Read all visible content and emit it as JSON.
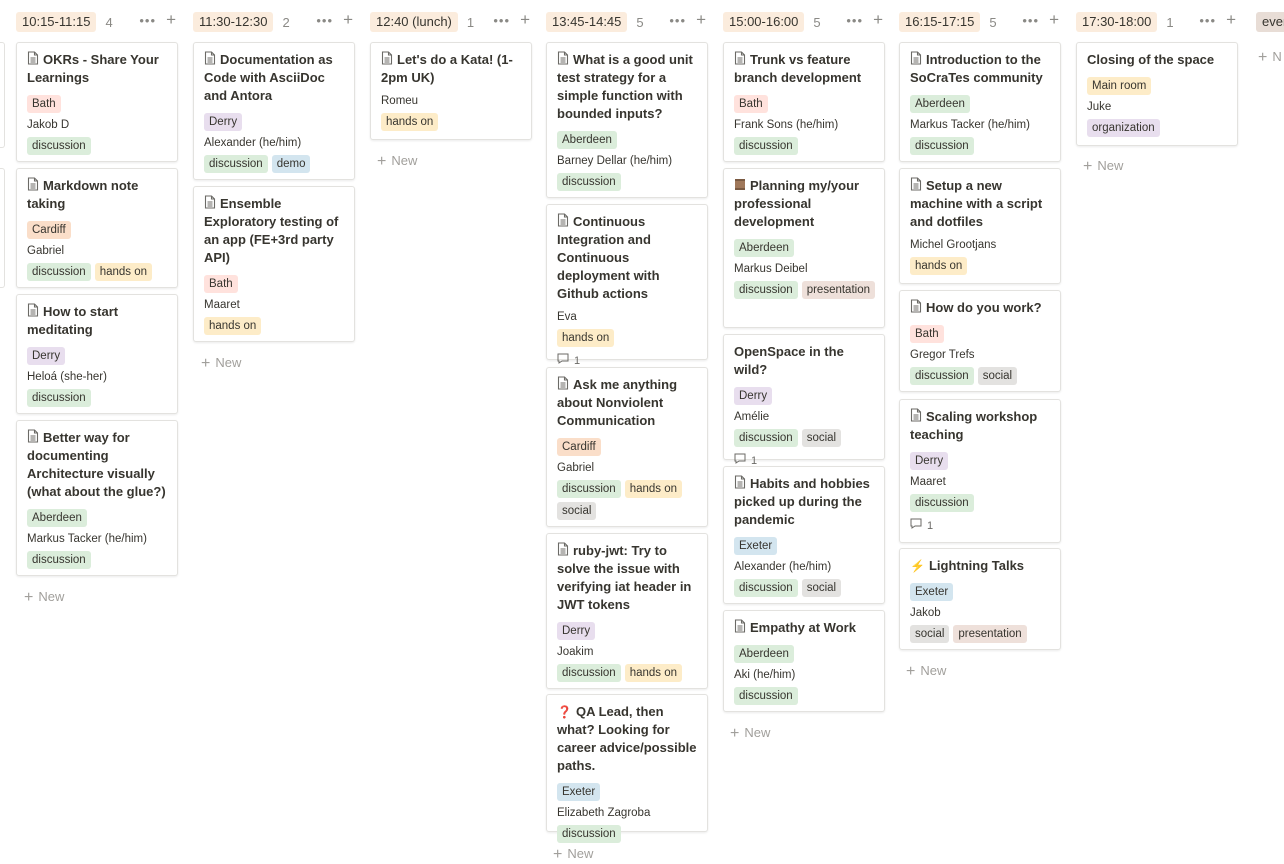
{
  "columns": [
    {
      "title": "10:15-11:15",
      "count": "4",
      "new_label": "New",
      "cards": [
        {
          "title": "OKRs - Share Your Learnings",
          "icon": "page-icon",
          "location": "Bath",
          "person": "Jakob D",
          "tags": [
            "discussion"
          ]
        },
        {
          "title": "Markdown note taking",
          "icon": "page-icon",
          "location": "Cardiff",
          "person": "Gabriel",
          "tags": [
            "discussion",
            "hands on"
          ]
        },
        {
          "title": "How to start meditating",
          "icon": "page-icon",
          "location": "Derry",
          "person": "Heloá (she-her)",
          "tags": [
            "discussion"
          ]
        },
        {
          "title": "Better way for documenting Architecture visually (what about the glue?)",
          "icon": "page-icon",
          "location": "Aberdeen",
          "person": "Markus Tacker (he/him)",
          "tags": [
            "discussion"
          ]
        }
      ]
    },
    {
      "title": "11:30-12:30",
      "count": "2",
      "new_label": "New",
      "cards": [
        {
          "title": "Documentation as Code with AsciiDoc and Antora",
          "icon": "page-icon",
          "location": "Derry",
          "person": "Alexander (he/him)",
          "tags": [
            "discussion",
            "demo"
          ]
        },
        {
          "title": "Ensemble Exploratory testing of an app (FE+3rd party API)",
          "icon": "page-icon",
          "location": "Bath",
          "person": "Maaret",
          "tags": [
            "hands on"
          ]
        }
      ]
    },
    {
      "title": "12:40 (lunch)",
      "count": "1",
      "new_label": "New",
      "cards": [
        {
          "title": "Let's do a Kata! (1-2pm UK)",
          "icon": "page-icon",
          "location": "",
          "person": "Romeu",
          "tags": [
            "hands on"
          ]
        }
      ]
    },
    {
      "title": "13:45-14:45",
      "count": "5",
      "new_label": "New",
      "cards": [
        {
          "title": "What is a good unit test strategy for a simple function with bounded inputs?",
          "icon": "page-icon",
          "location": "Aberdeen",
          "person": "Barney Dellar (he/him)",
          "tags": [
            "discussion"
          ]
        },
        {
          "title": "Continuous Integration and Continuous deployment with Github actions",
          "icon": "page-icon",
          "location": "",
          "person": "Eva",
          "tags": [
            "hands on"
          ],
          "comments": "1"
        },
        {
          "title": "Ask me anything about Nonviolent Communication",
          "icon": "page-icon",
          "location": "Cardiff",
          "person": "Gabriel",
          "tags": [
            "discussion",
            "hands on",
            "social"
          ]
        },
        {
          "title": "ruby-jwt: Try to solve the issue with verifying iat header in JWT tokens",
          "icon": "page-icon",
          "location": "Derry",
          "person": "Joakim",
          "tags": [
            "discussion",
            "hands on"
          ]
        },
        {
          "title": "QA Lead, then what? Looking for career advice/possible paths.",
          "icon": "question-icon",
          "location": "Exeter",
          "person": "Elizabeth Zagroba",
          "tags": [
            "discussion"
          ]
        }
      ]
    },
    {
      "title": "15:00-16:00",
      "count": "5",
      "new_label": "New",
      "cards": [
        {
          "title": "Trunk vs feature branch development",
          "icon": "page-icon",
          "location": "Bath",
          "person": "Frank Sons (he/him)",
          "tags": [
            "discussion"
          ]
        },
        {
          "title": "Planning my/your professional development",
          "icon": "scroll-icon",
          "location": "Aberdeen",
          "person": "Markus Deibel",
          "tags": [
            "discussion",
            "presentation"
          ]
        },
        {
          "title": "OpenSpace in the wild?",
          "icon": "",
          "location": "Derry",
          "person": "Amélie",
          "tags": [
            "discussion",
            "social"
          ],
          "comments": "1"
        },
        {
          "title": "Habits and hobbies picked up during the pandemic",
          "icon": "page-icon",
          "location": "Exeter",
          "person": "Alexander (he/him)",
          "tags": [
            "discussion",
            "social"
          ]
        },
        {
          "title": "Empathy at Work",
          "icon": "page-icon",
          "location": "Aberdeen",
          "person": "Aki (he/him)",
          "tags": [
            "discussion"
          ]
        }
      ]
    },
    {
      "title": "16:15-17:15",
      "count": "5",
      "new_label": "New",
      "cards": [
        {
          "title": "Introduction to the SoCraTes community",
          "icon": "page-icon",
          "location": "Aberdeen",
          "person": "Markus Tacker (he/him)",
          "tags": [
            "discussion"
          ]
        },
        {
          "title": "Setup a new machine  with a script and dotfiles",
          "icon": "page-icon",
          "location": "",
          "person": "Michel Grootjans",
          "tags": [
            "hands on"
          ]
        },
        {
          "title": "How do you work?",
          "icon": "page-icon",
          "location": "Bath",
          "person": "Gregor Trefs",
          "tags": [
            "discussion",
            "social"
          ]
        },
        {
          "title": "Scaling workshop teaching",
          "icon": "page-icon",
          "location": "Derry",
          "person": "Maaret",
          "tags": [
            "discussion"
          ],
          "comments": "1"
        },
        {
          "title": "Lightning Talks",
          "icon": "lightning-icon",
          "location": "Exeter",
          "person": "Jakob",
          "tags": [
            "social",
            "presentation"
          ]
        }
      ]
    },
    {
      "title": "17:30-18:00",
      "count": "1",
      "new_label": "New",
      "cards": [
        {
          "title": "Closing of the space",
          "icon": "",
          "location": "Main room",
          "person": "Juke",
          "tags": [
            "organization"
          ]
        }
      ]
    },
    {
      "title": "even",
      "count": "",
      "new_label": "N",
      "cards": []
    }
  ],
  "colors": {
    "header_tag": "#fbecdd",
    "Bath": "#ffe2dd",
    "Cardiff": "#fadec9",
    "Derry": "#e8deee",
    "Aberdeen": "#dbeddb",
    "Exeter": "#d3e5ef",
    "Main room": "#fdecc8",
    "discussion": "#dbeddb",
    "hands on": "#fdecc8",
    "demo": "#d3e5ef",
    "social": "#e3e2e0",
    "presentation": "#eee0da",
    "organization": "#e8deee"
  }
}
